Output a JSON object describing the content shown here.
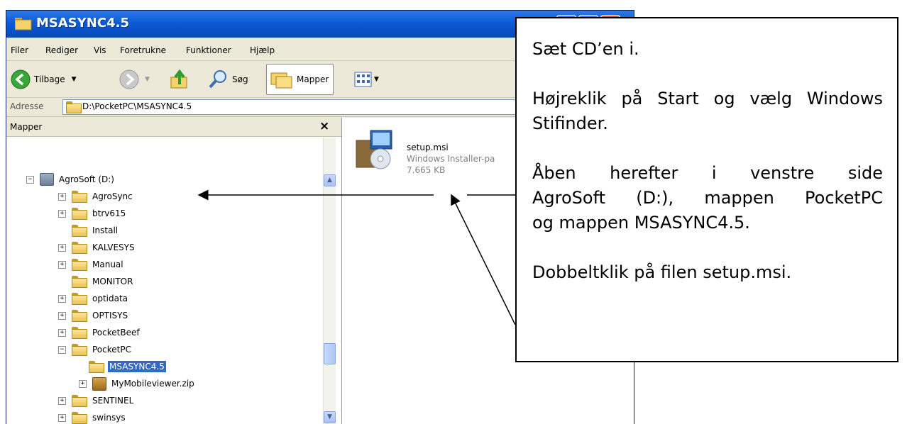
{
  "window": {
    "title": "MSASYNC4.5",
    "accent_color": "#0a5bd6"
  },
  "menu": [
    "Filer",
    "Rediger",
    "Vis",
    "Foretrukne",
    "Funktioner",
    "Hjælp"
  ],
  "toolbar": {
    "back_label": "Tilbage",
    "search_label": "Søg",
    "folders_label": "Mapper"
  },
  "address": {
    "label": "Adresse",
    "value": "D:\\PocketPC\\MSASYNC4.5"
  },
  "folders_pane": {
    "title": "Mapper",
    "close": "×",
    "tree": [
      {
        "label": "AgroSoft (D:)",
        "expander": "−"
      },
      {
        "label": "AgroSync",
        "expander": "+"
      },
      {
        "label": "btrv615",
        "expander": "+"
      },
      {
        "label": "Install",
        "expander": ""
      },
      {
        "label": "KALVESYS",
        "expander": "+"
      },
      {
        "label": "Manual",
        "expander": "+"
      },
      {
        "label": "MONITOR",
        "expander": ""
      },
      {
        "label": "optidata",
        "expander": "+"
      },
      {
        "label": "OPTISYS",
        "expander": "+"
      },
      {
        "label": "PocketBeef",
        "expander": "+"
      },
      {
        "label": "PocketPC",
        "expander": "−"
      },
      {
        "label": "MSASYNC4.5",
        "expander": ""
      },
      {
        "label": "MyMobileviewer.zip",
        "expander": "+"
      },
      {
        "label": "SENTINEL",
        "expander": "+"
      },
      {
        "label": "swinsys",
        "expander": "+"
      }
    ]
  },
  "file": {
    "name": "setup.msi",
    "type": "Windows Installer-pa",
    "size": "7.665 KB"
  },
  "callout": {
    "step1": "Sæt CD’en i.",
    "step2": "Højreklik på Start og vælg Windows Stifinder.",
    "step3_line1": "Åben herefter i venstre side",
    "step3_line2": "AgroSoft (D:), mappen PocketPC",
    "step3_line3": "og mappen MSASYNC4.5.",
    "step4": "Dobbeltklik på filen setup.msi."
  }
}
